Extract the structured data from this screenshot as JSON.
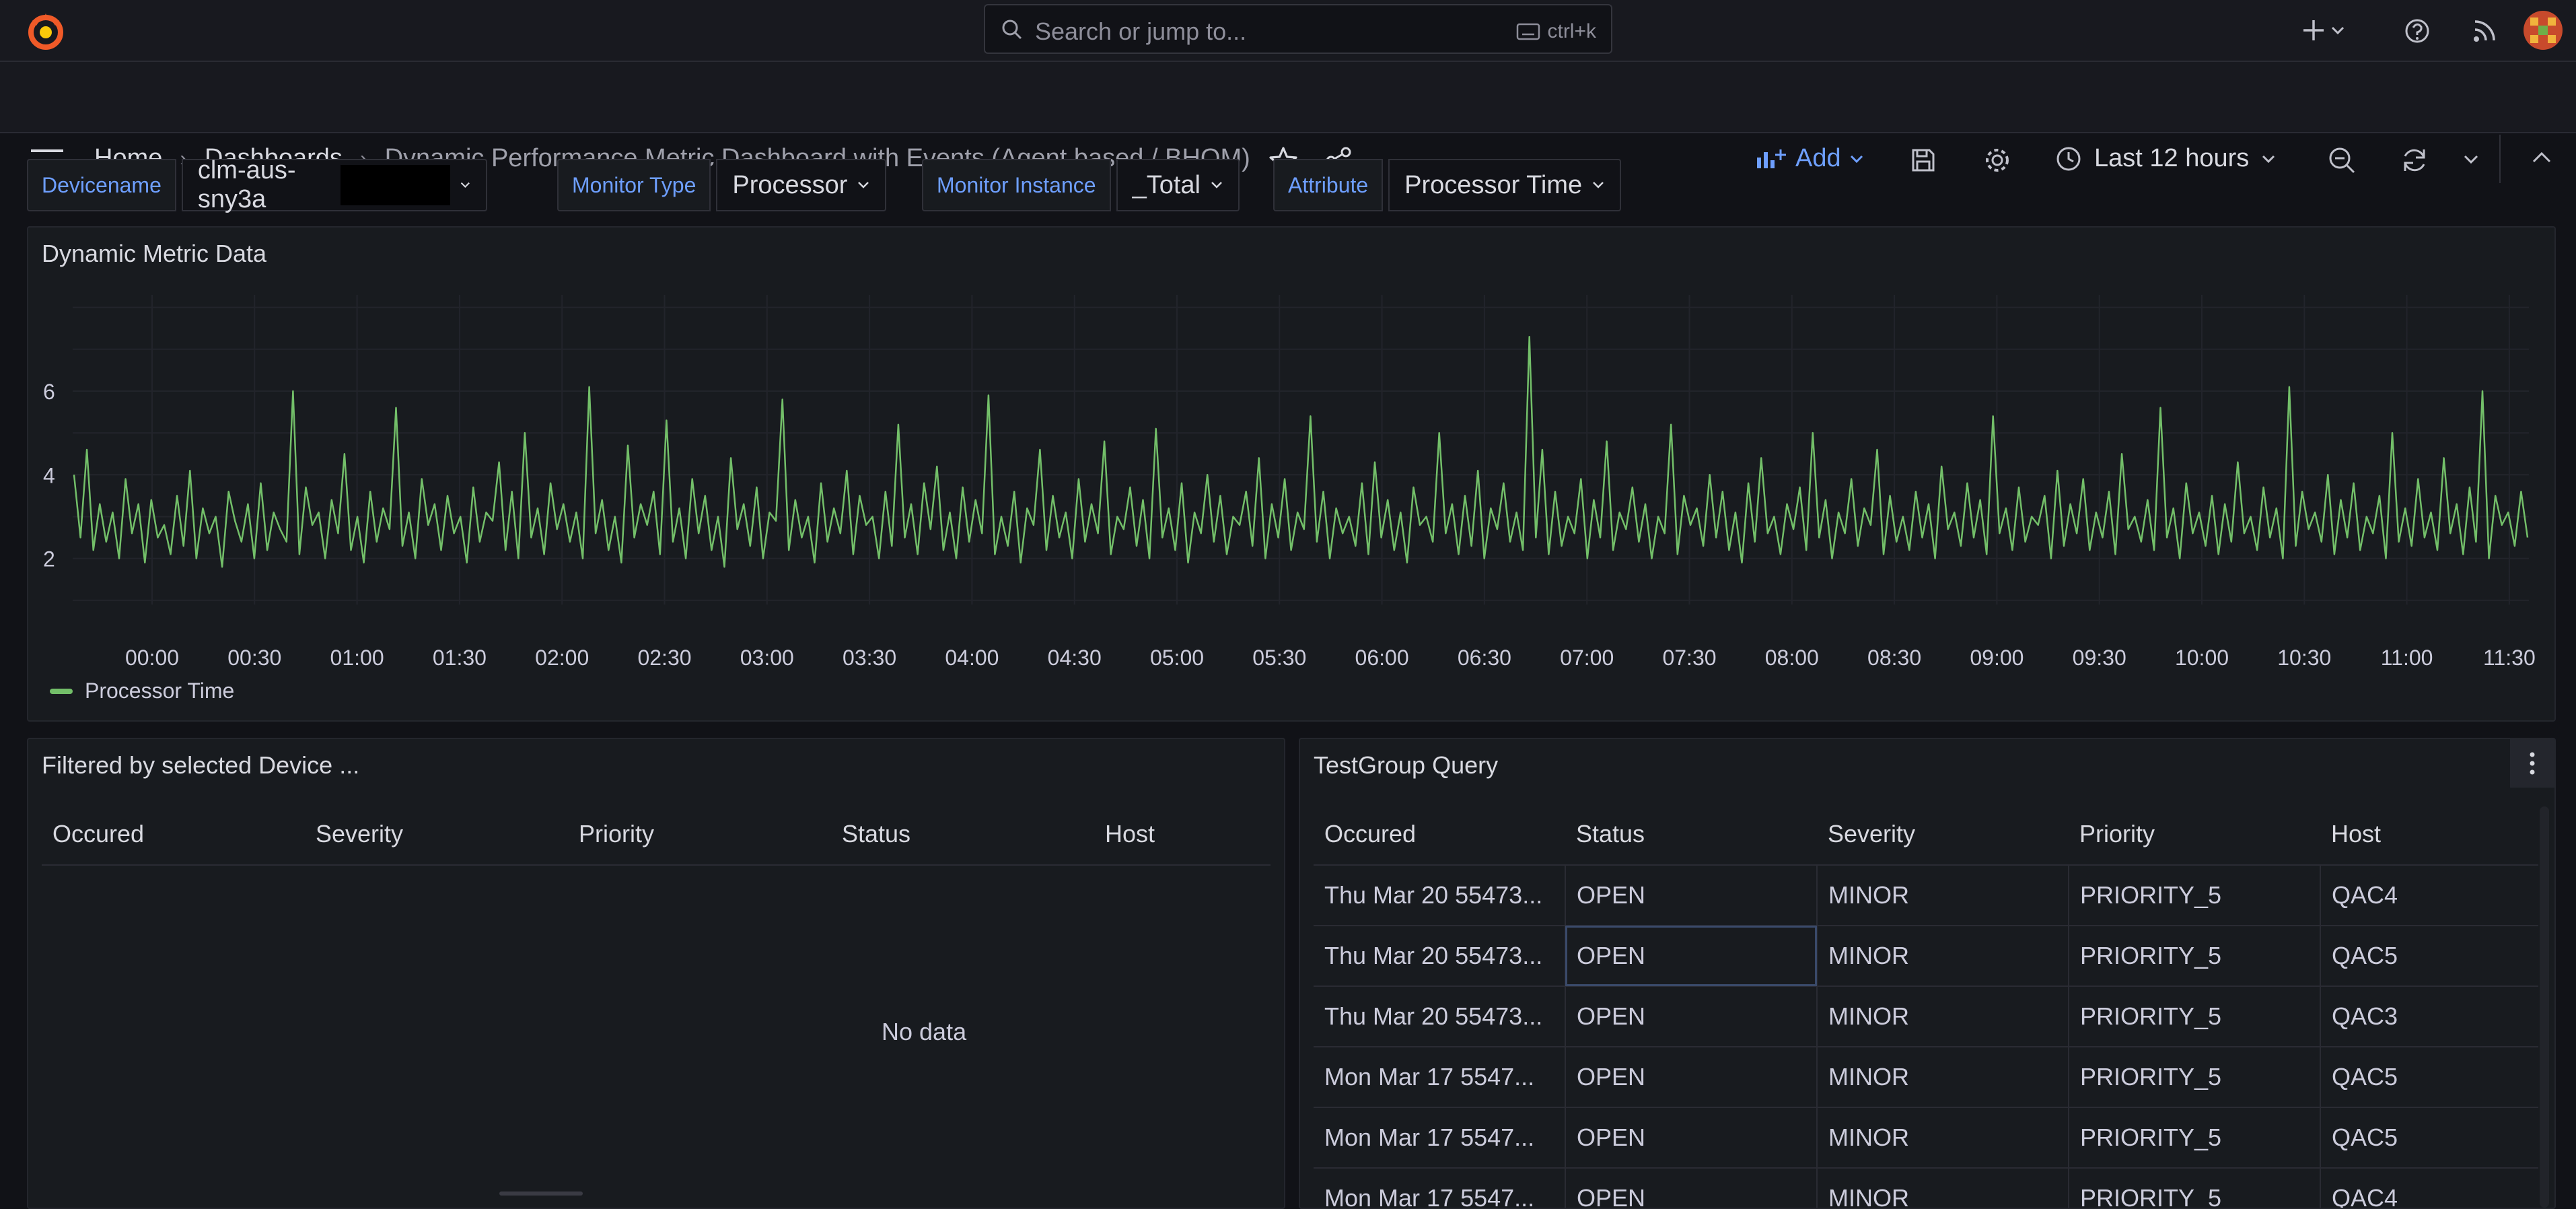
{
  "topbar": {
    "search_placeholder": "Search or jump to...",
    "search_shortcut": "ctrl+k"
  },
  "nav": {
    "breadcrumbs": [
      "Home",
      "Dashboards",
      "Dynamic Performance Metric Dashboard with Events (Agent based / BHOM)"
    ],
    "add_label": "Add",
    "time_range": "Last 12 hours"
  },
  "variables": [
    {
      "label": "Devicename",
      "value": "clm-aus-sny3a"
    },
    {
      "label": "Monitor Type",
      "value": "Processor"
    },
    {
      "label": "Monitor Instance",
      "value": "_Total"
    },
    {
      "label": "Attribute",
      "value": "Processor Time"
    }
  ],
  "chart_panel": {
    "title": "Dynamic Metric Data",
    "legend": "Processor Time"
  },
  "chart_data": {
    "type": "line",
    "series": [
      {
        "name": "Processor Time",
        "values": [
          4.0,
          2.5,
          4.6,
          2.2,
          3.3,
          2.4,
          3.1,
          2.0,
          3.9,
          2.6,
          3.3,
          1.9,
          3.4,
          2.5,
          2.8,
          2.1,
          3.5,
          2.3,
          4.1,
          2.0,
          3.2,
          2.6,
          3.0,
          1.8,
          3.6,
          2.9,
          2.4,
          3.3,
          2.0,
          3.8,
          2.2,
          3.1,
          2.7,
          2.4,
          6.0,
          2.1,
          3.7,
          2.8,
          3.1,
          2.0,
          3.4,
          2.6,
          4.5,
          2.2,
          3.0,
          1.9,
          3.6,
          2.4,
          3.2,
          2.7,
          5.6,
          2.3,
          3.1,
          2.0,
          3.9,
          2.8,
          3.3,
          2.2,
          3.5,
          2.6,
          3.0,
          1.9,
          3.7,
          2.4,
          3.1,
          2.9,
          4.3,
          2.2,
          3.6,
          2.0,
          5.0,
          2.5,
          3.2,
          2.1,
          3.8,
          2.7,
          3.3,
          2.4,
          3.1,
          2.0,
          6.1,
          2.6,
          3.4,
          2.2,
          3.0,
          1.9,
          4.7,
          2.5,
          3.3,
          2.8,
          3.6,
          2.1,
          5.3,
          2.4,
          3.2,
          2.0,
          3.9,
          2.6,
          3.5,
          2.2,
          3.0,
          1.8,
          4.4,
          2.7,
          3.3,
          2.3,
          3.7,
          2.0,
          3.1,
          2.9,
          5.8,
          2.2,
          3.4,
          2.5,
          3.0,
          1.9,
          3.8,
          2.4,
          3.2,
          2.6,
          4.1,
          2.1,
          3.5,
          2.8,
          3.0,
          2.0,
          3.6,
          2.3,
          5.2,
          2.5,
          3.3,
          2.1,
          3.8,
          2.7,
          4.2,
          2.2,
          3.1,
          2.0,
          3.7,
          2.4,
          3.4,
          2.6,
          5.9,
          2.1,
          3.0,
          2.3,
          3.6,
          1.9,
          3.2,
          2.8,
          4.6,
          2.2,
          3.5,
          2.5,
          3.1,
          2.0,
          3.9,
          2.4,
          3.3,
          2.6,
          4.8,
          2.1,
          3.0,
          2.7,
          3.7,
          2.3,
          3.4,
          2.0,
          5.1,
          2.5,
          3.2,
          2.2,
          3.8,
          1.9,
          3.1,
          2.6,
          4.0,
          2.4,
          3.5,
          2.1,
          3.0,
          2.8,
          3.6,
          2.3,
          4.4,
          2.0,
          3.3,
          2.5,
          3.9,
          2.2,
          3.1,
          2.7,
          5.4,
          2.4,
          3.6,
          2.0,
          3.2,
          2.6,
          3.0,
          2.3,
          3.8,
          2.1,
          4.3,
          2.5,
          3.4,
          2.2,
          3.1,
          1.9,
          3.7,
          2.8,
          3.0,
          2.4,
          5.0,
          2.6,
          3.3,
          2.1,
          3.5,
          2.3,
          4.1,
          2.0,
          3.2,
          2.7,
          3.8,
          2.4,
          3.1,
          2.2,
          7.3,
          2.5,
          4.6,
          2.1,
          3.6,
          2.3,
          3.0,
          2.6,
          3.9,
          2.0,
          3.4,
          2.5,
          4.8,
          2.2,
          3.1,
          2.7,
          3.7,
          2.4,
          3.3,
          2.0,
          3.0,
          2.6,
          5.2,
          2.1,
          3.5,
          2.8,
          3.2,
          2.3,
          4.0,
          2.5,
          3.6,
          2.2,
          3.1,
          1.9,
          3.8,
          2.4,
          4.4,
          2.6,
          3.0,
          2.1,
          3.3,
          2.7,
          3.7,
          2.2,
          5.0,
          2.5,
          3.4,
          2.0,
          3.1,
          2.6,
          3.9,
          2.3,
          3.2,
          2.8,
          4.6,
          2.1,
          3.5,
          2.4,
          3.0,
          2.2,
          3.6,
          2.5,
          3.3,
          2.0,
          4.2,
          2.7,
          3.1,
          2.3,
          3.8,
          2.5,
          3.4,
          2.1,
          5.4,
          2.6,
          3.2,
          2.2,
          3.7,
          2.4,
          3.0,
          2.8,
          3.5,
          2.0,
          4.1,
          2.3,
          3.3,
          2.6,
          3.9,
          2.2,
          3.1,
          2.5,
          3.6,
          2.1,
          4.5,
          2.7,
          3.0,
          2.4,
          3.4,
          2.2,
          5.6,
          2.5,
          3.2,
          2.0,
          3.8,
          2.6,
          3.1,
          2.3,
          3.5,
          2.1,
          3.3,
          2.4,
          4.3,
          2.6,
          3.0,
          2.2,
          3.7,
          2.5,
          3.2,
          2.0,
          6.1,
          2.3,
          3.6,
          2.7,
          3.1,
          2.4,
          4.0,
          2.1,
          3.4,
          2.5,
          3.8,
          2.2,
          3.0,
          2.6,
          3.5,
          2.0,
          5.0,
          2.4,
          3.2,
          2.3,
          3.9,
          2.5,
          3.1,
          2.2,
          4.4,
          2.6,
          3.3,
          2.1,
          3.7,
          2.4,
          6.0,
          2.0,
          3.5,
          2.8,
          3.1,
          2.3,
          3.6,
          2.5
        ]
      }
    ],
    "x_tick_labels": [
      "00:00",
      "00:30",
      "01:00",
      "01:30",
      "02:00",
      "02:30",
      "03:00",
      "03:30",
      "04:00",
      "04:30",
      "05:00",
      "05:30",
      "06:00",
      "06:30",
      "07:00",
      "07:30",
      "08:00",
      "08:30",
      "09:00",
      "09:30",
      "10:00",
      "10:30",
      "11:00",
      "11:30"
    ],
    "y_tick_labels": [
      "2",
      "4",
      "6"
    ],
    "ylim": [
      0.9,
      8.3
    ],
    "grid": true,
    "legend_position": "bottom-left",
    "colors": {
      "series": "#73bf69"
    }
  },
  "left_panel": {
    "title": "Filtered by selected Device ...",
    "columns": [
      "Occured",
      "Severity",
      "Priority",
      "Status",
      "Host"
    ],
    "no_data": "No data"
  },
  "right_panel": {
    "title": "TestGroup Query",
    "columns": [
      "Occured",
      "Status",
      "Severity",
      "Priority",
      "Host"
    ],
    "rows": [
      [
        "Thu Mar 20 55473...",
        "OPEN",
        "MINOR",
        "PRIORITY_5",
        "QAC4"
      ],
      [
        "Thu Mar 20 55473...",
        "OPEN",
        "MINOR",
        "PRIORITY_5",
        "QAC5"
      ],
      [
        "Thu Mar 20 55473...",
        "OPEN",
        "MINOR",
        "PRIORITY_5",
        "QAC3"
      ],
      [
        "Mon Mar 17 5547...",
        "OPEN",
        "MINOR",
        "PRIORITY_5",
        "QAC5"
      ],
      [
        "Mon Mar 17 5547...",
        "OPEN",
        "MINOR",
        "PRIORITY_5",
        "QAC5"
      ],
      [
        "Mon Mar 17 5547...",
        "OPEN",
        "MINOR",
        "PRIORITY_5",
        "QAC4"
      ]
    ]
  },
  "colors": {
    "accent": "#6e9fff",
    "logo": "#f05a28"
  }
}
